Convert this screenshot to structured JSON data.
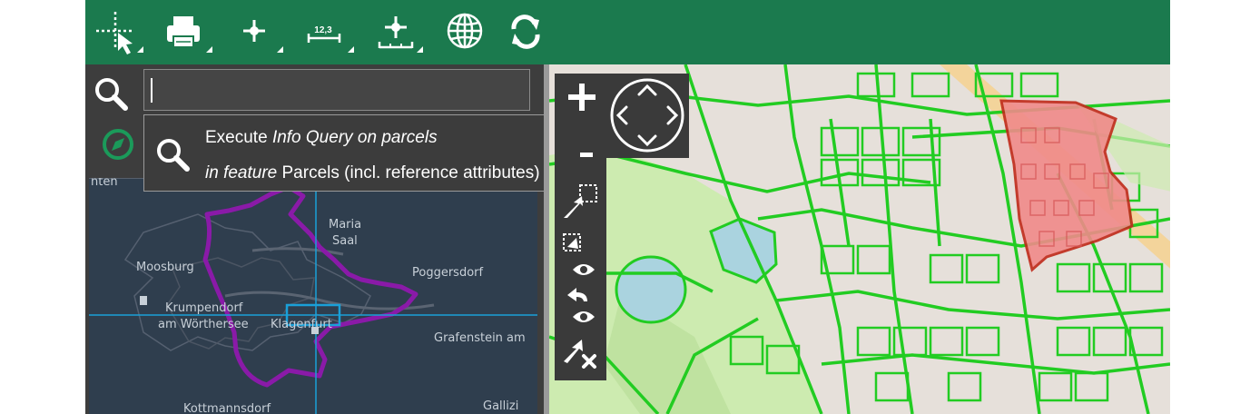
{
  "toolbar": {
    "tools": [
      {
        "name": "select-tool",
        "icon": "crosshair-pointer-icon"
      },
      {
        "name": "print-tool",
        "icon": "printer-icon"
      },
      {
        "name": "point-tool",
        "icon": "point-crosshair-icon"
      },
      {
        "name": "measure-tool",
        "icon": "measure-icon",
        "label": "12,3"
      },
      {
        "name": "coordinate-tool",
        "icon": "coordinate-ruler-icon"
      },
      {
        "name": "globe-tool",
        "icon": "globe-icon"
      },
      {
        "name": "refresh-tool",
        "icon": "refresh-icon"
      }
    ],
    "background": "#1b7a4e"
  },
  "search": {
    "value": "",
    "placeholder": "",
    "icon": "search-icon"
  },
  "suggestion": {
    "line1_a": "Execute ",
    "line1_b": "Info Query on parcels",
    "line2_a": "in feature",
    "line2_b": " Parcels (incl. reference attributes)",
    "icon": "search-icon"
  },
  "overview_map": {
    "labels": [
      "nten",
      "Maria",
      "Saal",
      "Moosburg",
      "Poggersdorf",
      "Krumpendorf",
      "am Wörthersee",
      "Klagenfurt",
      "Grafenstein am",
      "Kottmannsdorf",
      "Gallizi"
    ],
    "colors": {
      "boundary": "#8a1aa8",
      "crosshair": "#1aa0d8"
    }
  },
  "main_map": {
    "colors": {
      "parcel": "#22cc22",
      "selected_fill": "#f08a8a",
      "selected_outline": "#c02a1a",
      "water": "#aad3df",
      "park": "#cdebb0"
    }
  },
  "navigation": {
    "zoom_in_icon": "plus-icon",
    "zoom_out_icon": "minus-icon",
    "pan_icon": "pan-arrows-icon",
    "strip": [
      "select-rect-icon",
      "select-clear-icon",
      "eye-icon",
      "undo-icon",
      "eye-icon",
      "pointer-close-icon"
    ]
  }
}
